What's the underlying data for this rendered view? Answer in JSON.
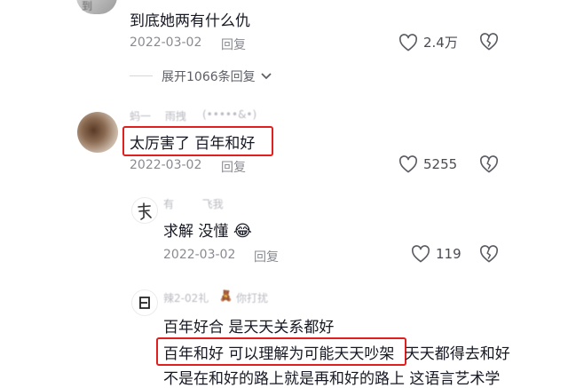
{
  "comments": [
    {
      "name": "到",
      "text": "到底她两有什么仇",
      "date": "2022-03-02",
      "reply": "回复",
      "likes": "2.4万"
    },
    {
      "name": "蚂一 　雨拽",
      "text": "太厉害了 百年和好",
      "date": "2022-03-02",
      "reply": "回复",
      "likes": "5255"
    }
  ],
  "expand_label": "展开1066条回复",
  "replies": [
    {
      "name": "有　 　 飞我",
      "text": "求解 没懂",
      "emoji": "😂",
      "date": "2022-03-02",
      "reply": "回复",
      "likes": "119"
    },
    {
      "name": "辣2-02礼",
      "name_tail": "你打扰",
      "line1": "百年好合 是天天关系都好",
      "line2_highlight": "百年和好 可以理解为可能天天吵架",
      "line2_rest": "天天都得去和好",
      "line3": "不是在和好的路上就是再和好的路上 这语言艺术学"
    }
  ],
  "icons": {
    "like": "heart-outline-icon",
    "dislike": "broken-heart-icon",
    "expand": "chevron-down-icon"
  },
  "colors": {
    "highlight": "#e0201f",
    "meta": "#8a8b91",
    "text": "#161823"
  }
}
